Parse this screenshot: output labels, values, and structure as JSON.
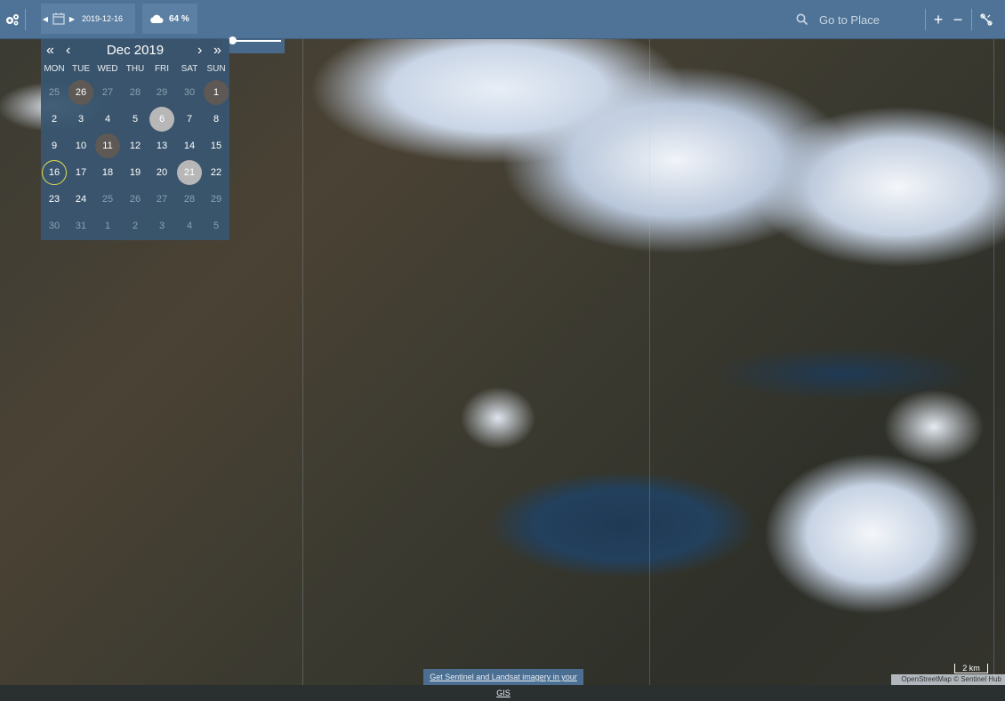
{
  "toolbar": {
    "date": "2019-12-16",
    "cloud_coverage": "64 %",
    "search_placeholder": "Go to Place",
    "zoom_in": "+",
    "zoom_out": "−"
  },
  "calendar": {
    "month_title": "Dec 2019",
    "nav_prev_year": "«",
    "nav_prev_month": "‹",
    "nav_next_month": "›",
    "nav_next_year": "»",
    "weekdays": [
      "MON",
      "TUE",
      "WED",
      "THU",
      "FRI",
      "SAT",
      "SUN"
    ],
    "weeks": [
      [
        "25",
        "26",
        "27",
        "28",
        "29",
        "30",
        "1"
      ],
      [
        "2",
        "3",
        "4",
        "5",
        "6",
        "7",
        "8"
      ],
      [
        "9",
        "10",
        "11",
        "12",
        "13",
        "14",
        "15"
      ],
      [
        "16",
        "17",
        "18",
        "19",
        "20",
        "21",
        "22"
      ],
      [
        "23",
        "24",
        "25",
        "26",
        "27",
        "28",
        "29"
      ],
      [
        "30",
        "31",
        "1",
        "2",
        "3",
        "4",
        "5"
      ]
    ]
  },
  "footer": {
    "gis_link": "Get Sentinel and Landsat imagery in your GIS",
    "scale": "2 km",
    "attribution": "OpenStreetMap © Sentinel Hub"
  },
  "colors": {
    "toolbar": "#4f7396",
    "calendar_bg": "#385670",
    "available_date": "#5e5954",
    "highlight_date": "#b7b7b7",
    "selected_ring": "#e3e24c"
  },
  "icons": {
    "settings": "settings-gears-icon",
    "calendar": "calendar-icon",
    "cloud": "cloud-icon",
    "search": "search-icon",
    "measure": "measure-icon"
  }
}
